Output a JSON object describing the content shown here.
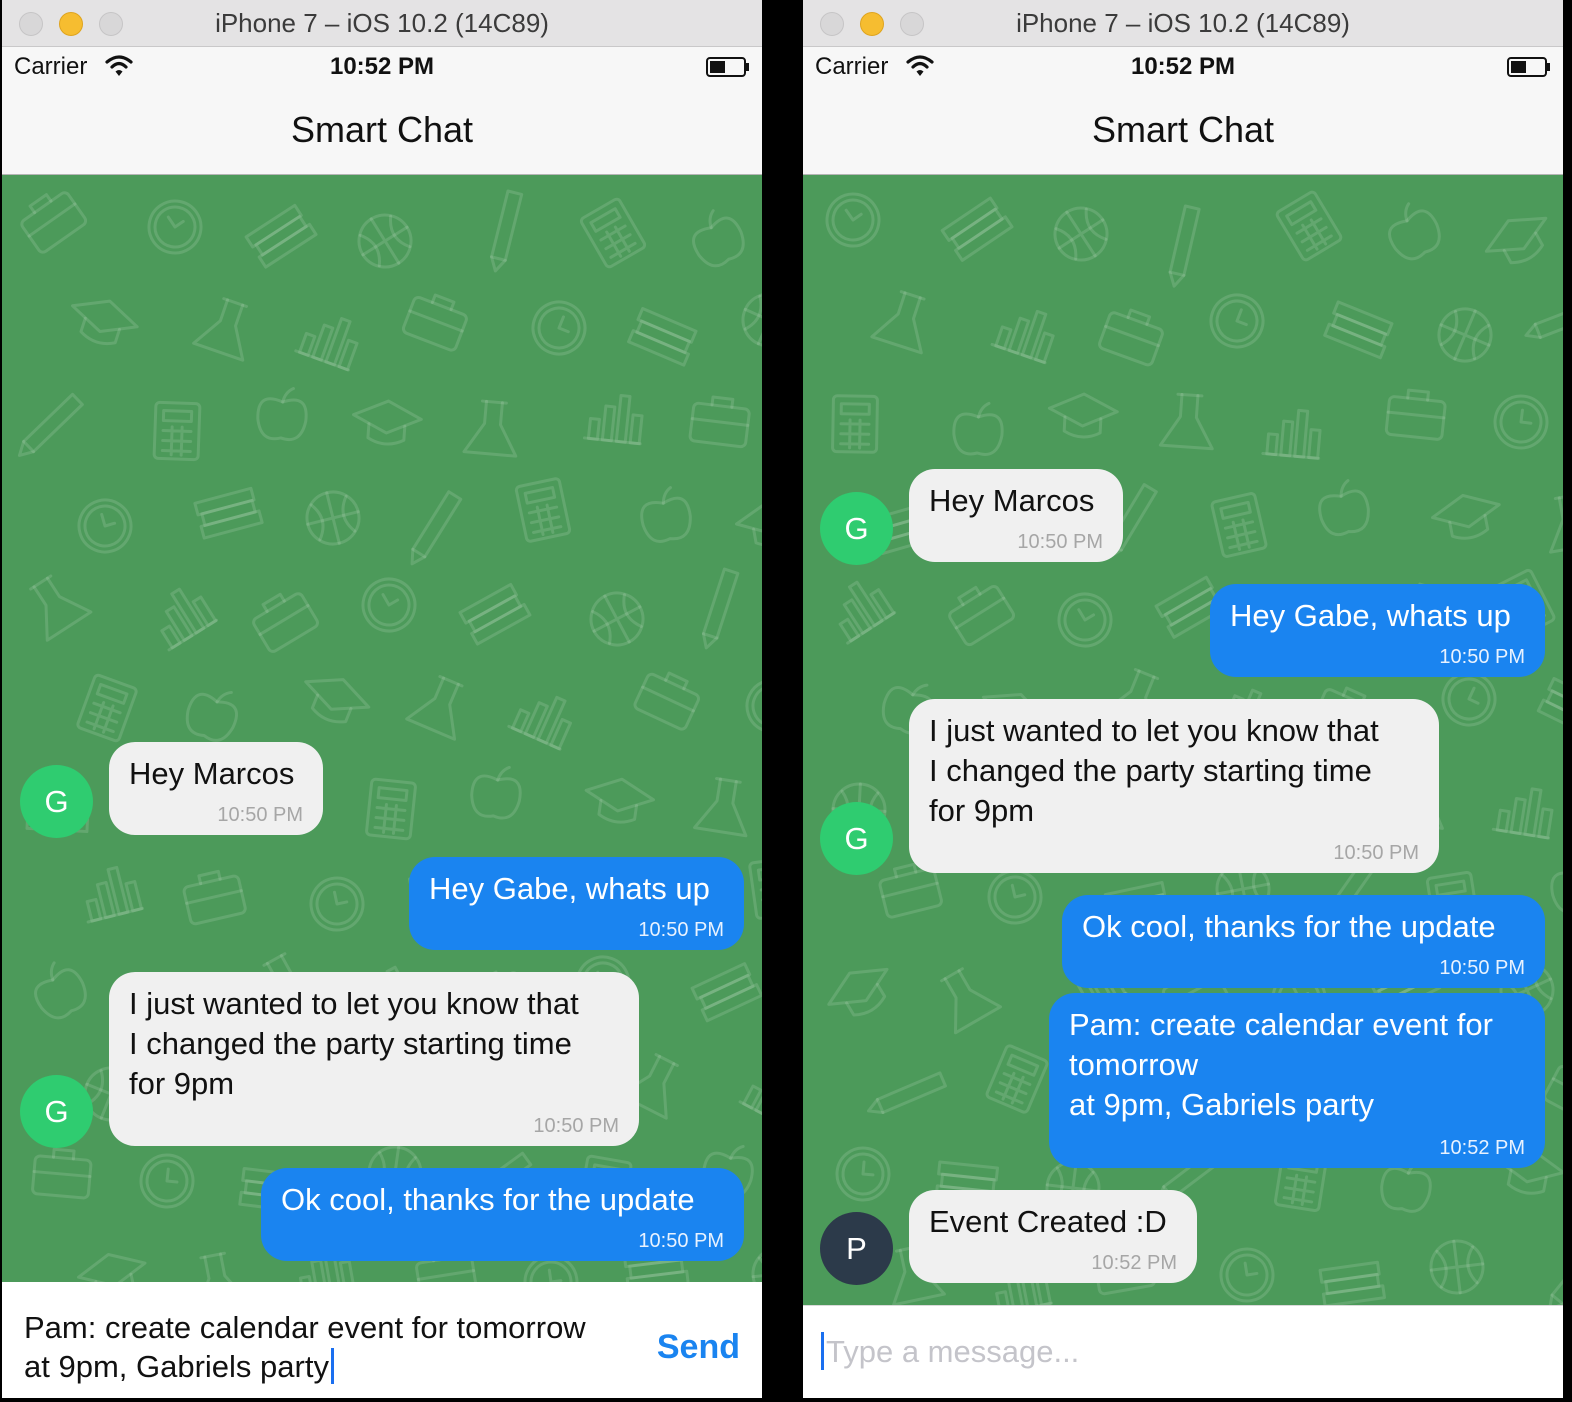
{
  "colors": {
    "chat_bg": "#4c9a5a",
    "outgoing_bubble": "#1a84f0",
    "incoming_bubble": "#f0f0f0",
    "avatar_g": "#2fcc70",
    "avatar_p": "#2c3a4a",
    "send": "#1a84f0"
  },
  "left": {
    "window_title": "iPhone 7 – iOS 10.2 (14C89)",
    "status": {
      "carrier": "Carrier",
      "time": "10:52 PM"
    },
    "nav_title": "Smart Chat",
    "messages": [
      {
        "text": "Hey Marcos",
        "time": "10:50 PM",
        "avatar": "G"
      },
      {
        "text": "Hey Gabe, whats up",
        "time": "10:50 PM"
      },
      {
        "text": "I just wanted to let you know that\nI changed the party starting time\nfor 9pm",
        "time": "10:50 PM",
        "avatar": "G"
      },
      {
        "text": "Ok cool, thanks for the update",
        "time": "10:50 PM"
      }
    ],
    "composer": {
      "value": "Pam: create calendar event for tomorrow\nat 9pm, Gabriels party",
      "send_label": "Send"
    }
  },
  "right": {
    "window_title": "iPhone 7 – iOS 10.2 (14C89)",
    "status": {
      "carrier": "Carrier",
      "time": "10:52 PM"
    },
    "nav_title": "Smart Chat",
    "messages": [
      {
        "text": "Hey Marcos",
        "time": "10:50 PM",
        "avatar": "G"
      },
      {
        "text": "Hey Gabe, whats up",
        "time": "10:50 PM"
      },
      {
        "text": "I just wanted to let you know that\nI changed the party starting time\nfor 9pm",
        "time": "10:50 PM",
        "avatar": "G"
      },
      {
        "text": "Ok cool, thanks for the update",
        "time": "10:50 PM"
      },
      {
        "text": "Pam: create calendar event for\ntomorrow\nat 9pm, Gabriels party",
        "time": "10:52 PM"
      },
      {
        "text": "Event Created :D",
        "time": "10:52 PM",
        "avatar": "P"
      }
    ],
    "composer": {
      "placeholder": "Type a message..."
    }
  }
}
